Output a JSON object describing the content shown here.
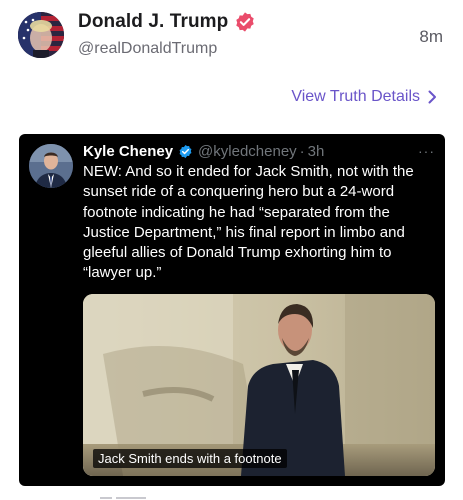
{
  "post": {
    "author_name": "Donald J. Trump",
    "author_handle": "@realDonaldTrump",
    "time_ago": "8m",
    "view_details_label": "View Truth Details"
  },
  "quoted": {
    "name": "Kyle Cheney",
    "handle": "@kyledcheney",
    "separator": "·",
    "time": "3h",
    "more_label": "···",
    "text": "NEW: And so it ended for Jack Smith, not with the sunset ride of a conquering hero but a 24-word footnote indicating he had “separated from the Justice Department,” his final report in limbo and gleeful allies of Donald Trump exhorting him to “lawyer up.”",
    "media_caption": "Jack Smith ends with a footnote"
  },
  "colors": {
    "link": "#6a55c9",
    "verified_badge": "#ea4c6b",
    "x_verified": "#1d9bf0",
    "card_bg": "#000000"
  },
  "icons": {
    "verified": "verified-badge-icon",
    "chevron": "chevron-right-icon",
    "more": "more-dots-icon"
  }
}
